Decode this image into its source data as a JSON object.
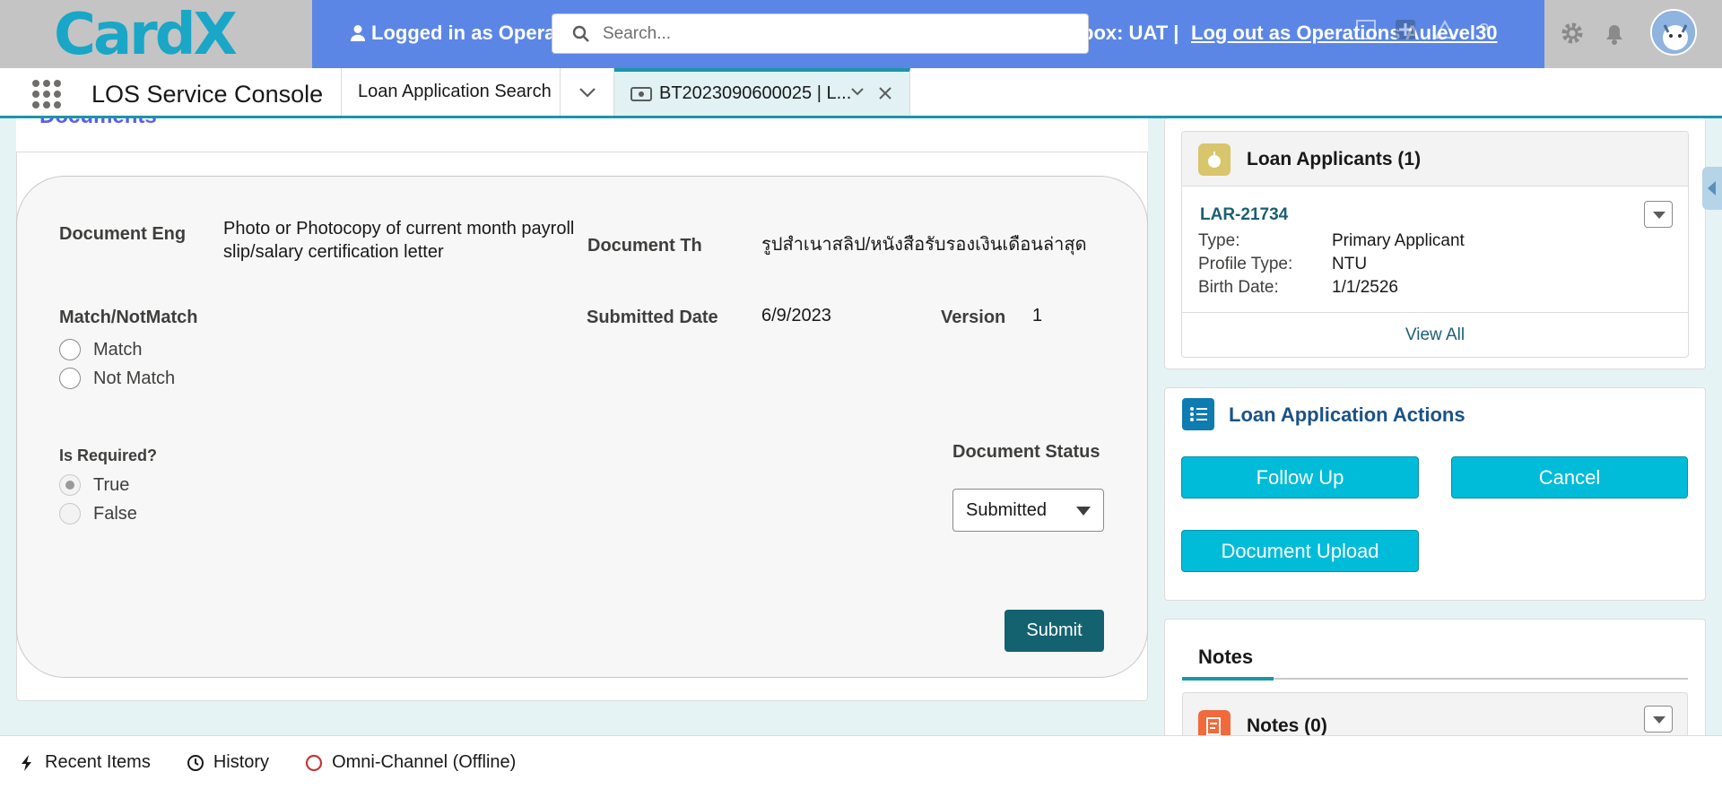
{
  "header": {
    "logo_text": "CardX",
    "logged_in_text": "Logged in as Opera",
    "search_placeholder": "Search...",
    "sandbox_text": "box: UAT |",
    "logout_text": "Log out as Operations Au",
    "logout_suffix": "level30"
  },
  "nav": {
    "app_name": "LOS Service Console",
    "tabs": [
      {
        "label": "Loan Application Search"
      },
      {
        "label": "BT2023090600025 | L..."
      }
    ]
  },
  "documents": {
    "section_title": "Documents",
    "fields": {
      "doc_eng_label": "Document Eng",
      "doc_eng_value": "Photo or Photocopy of current month payroll slip/salary certification letter",
      "doc_th_label": "Document Th",
      "doc_th_value": "รูปสำเนาสลิป/หนังสือรับรองเงินเดือนล่าสุด",
      "match_label": "Match/NotMatch",
      "match_options": [
        "Match",
        "Not Match"
      ],
      "submitted_date_label": "Submitted Date",
      "submitted_date_value": "6/9/2023",
      "version_label": "Version",
      "version_value": "1",
      "is_required_label": "Is Required?",
      "is_required_options": [
        "True",
        "False"
      ],
      "is_required_selected": "True",
      "doc_status_label": "Document Status",
      "doc_status_value": "Submitted"
    },
    "submit_label": "Submit"
  },
  "applicants": {
    "title": "Loan Applicants (1)",
    "record_id": "LAR-21734",
    "rows": [
      {
        "key": "Type:",
        "value": "Primary Applicant"
      },
      {
        "key": "Profile Type:",
        "value": "NTU"
      },
      {
        "key": "Birth Date:",
        "value": "1/1/2526"
      }
    ],
    "view_all": "View All"
  },
  "actions": {
    "title": "Loan Application Actions",
    "buttons": [
      "Follow Up",
      "Cancel",
      "Document Upload"
    ]
  },
  "notes": {
    "tab_label": "Notes",
    "title": "Notes (0)"
  },
  "utility": {
    "items": [
      "Recent Items",
      "History",
      "Omni-Channel (Offline)"
    ]
  },
  "colors": {
    "header_blue": "#5b86e5",
    "brand_teal": "#1b96a8",
    "action_cyan": "#00bcd9",
    "submit_teal": "#14626f"
  }
}
